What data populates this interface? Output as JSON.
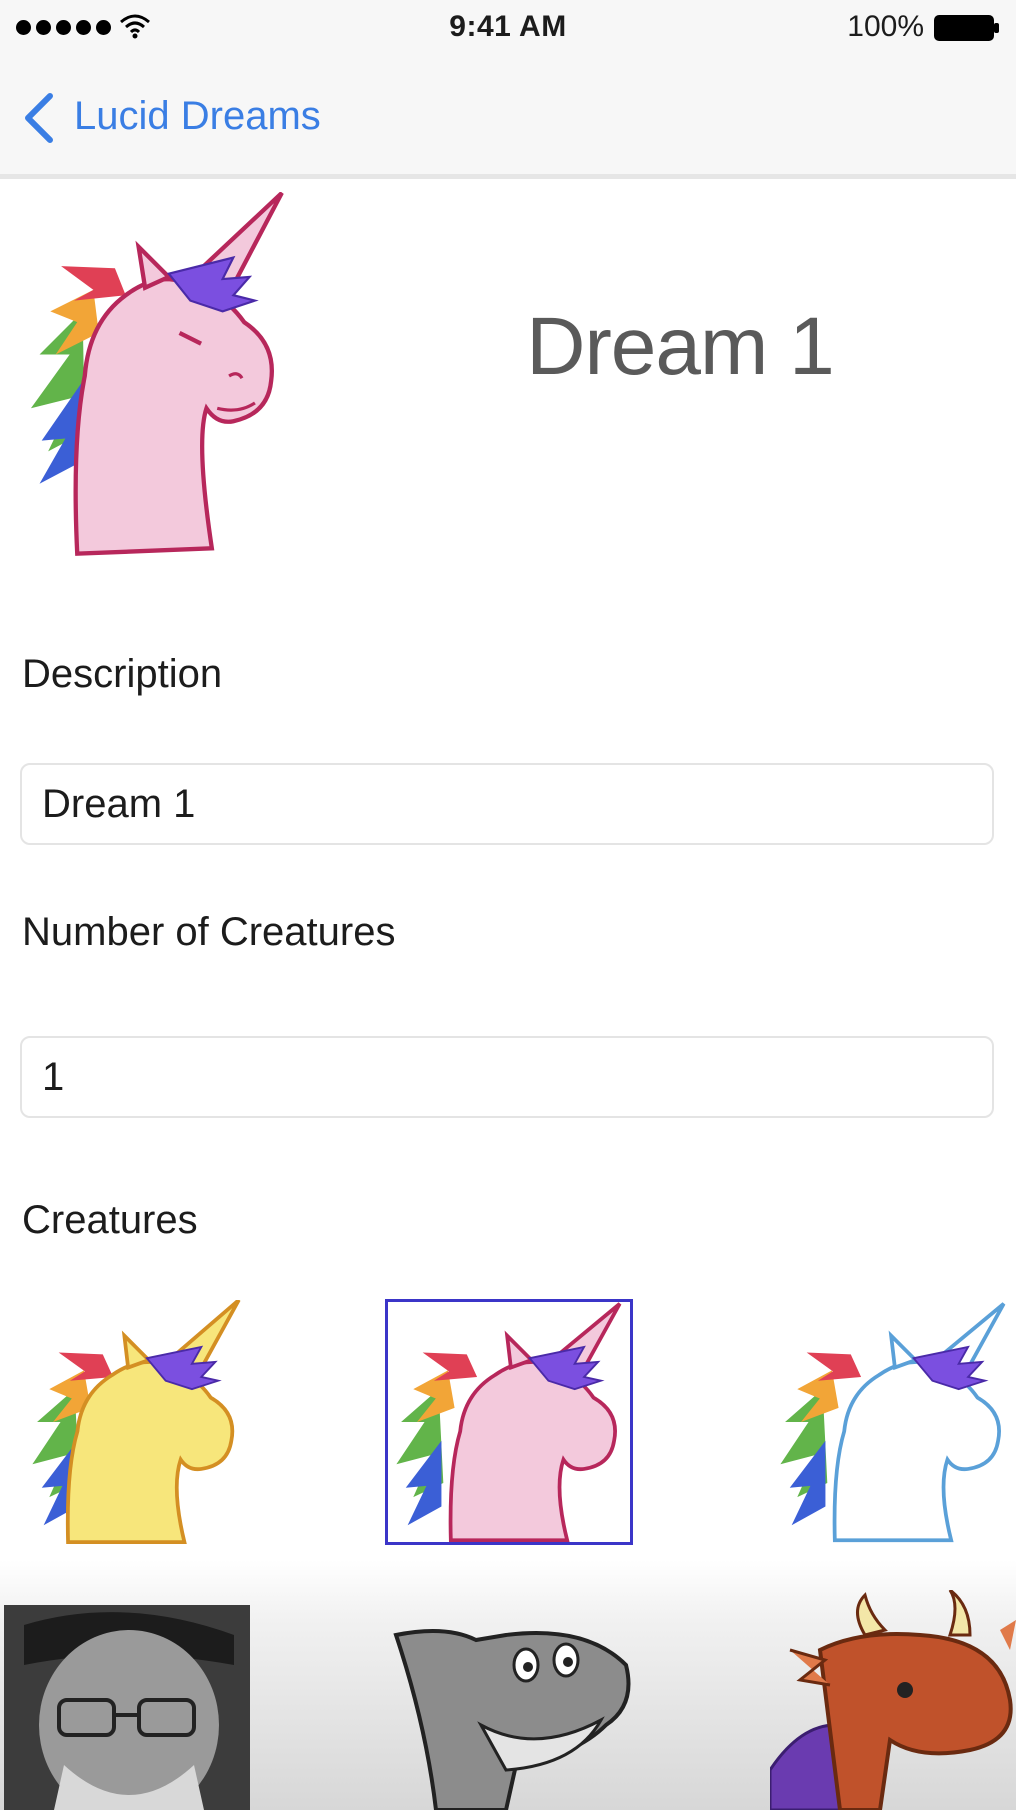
{
  "status_bar": {
    "signal_icon": "signal-dots-icon",
    "wifi_icon": "wifi-icon",
    "time": "9:41 AM",
    "battery_percent": "100%",
    "battery_icon": "battery-full-icon"
  },
  "nav": {
    "back_icon": "chevron-left-icon",
    "back_label": "Lucid Dreams",
    "accent_color": "#3a7ee4"
  },
  "dream": {
    "title": "Dream 1",
    "image": "unicorn-pink"
  },
  "form": {
    "description_label": "Description",
    "description_value": "Dream 1",
    "count_label": "Number of Creatures",
    "count_value": "1"
  },
  "creatures": {
    "label": "Creatures",
    "items": [
      {
        "name": "unicorn-yellow",
        "selected": false
      },
      {
        "name": "unicorn-pink",
        "selected": true
      },
      {
        "name": "unicorn-white",
        "selected": false
      },
      {
        "name": "man-photo",
        "selected": false
      },
      {
        "name": "shark",
        "selected": false
      },
      {
        "name": "dragon",
        "selected": false
      }
    ],
    "selection_color": "#3b35c8"
  }
}
